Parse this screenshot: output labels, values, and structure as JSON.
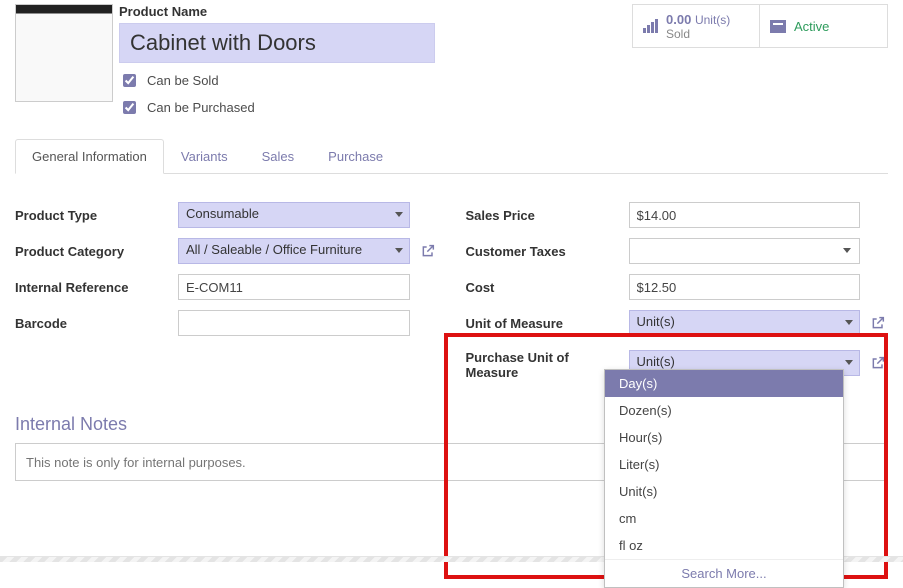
{
  "header": {
    "product_name_label": "Product Name",
    "product_name_value": "Cabinet with Doors",
    "can_sold": "Can be Sold",
    "can_purchased": "Can be Purchased"
  },
  "stats": {
    "sold_value": "0.00",
    "sold_unit": "Unit(s)",
    "sold_label": "Sold",
    "active_label": "Active"
  },
  "tabs": [
    "General Information",
    "Variants",
    "Sales",
    "Purchase"
  ],
  "left": {
    "product_type_label": "Product Type",
    "product_type_value": "Consumable",
    "product_category_label": "Product Category",
    "product_category_value": "All / Saleable / Office Furniture",
    "internal_ref_label": "Internal Reference",
    "internal_ref_value": "E-COM11",
    "barcode_label": "Barcode",
    "barcode_value": ""
  },
  "right": {
    "sales_price_label": "Sales Price",
    "sales_price_value": "$14.00",
    "customer_taxes_label": "Customer Taxes",
    "customer_taxes_value": "",
    "cost_label": "Cost",
    "cost_value": "$12.50",
    "uom_label": "Unit of Measure",
    "uom_value": "Unit(s)",
    "puom_label": "Purchase Unit of Measure",
    "puom_value": "Unit(s)"
  },
  "notes": {
    "heading": "Internal Notes",
    "placeholder": "This note is only for internal purposes."
  },
  "dropdown": {
    "options": [
      "Day(s)",
      "Dozen(s)",
      "Hour(s)",
      "Liter(s)",
      "Unit(s)",
      "cm",
      "fl oz"
    ],
    "search_more": "Search More..."
  }
}
